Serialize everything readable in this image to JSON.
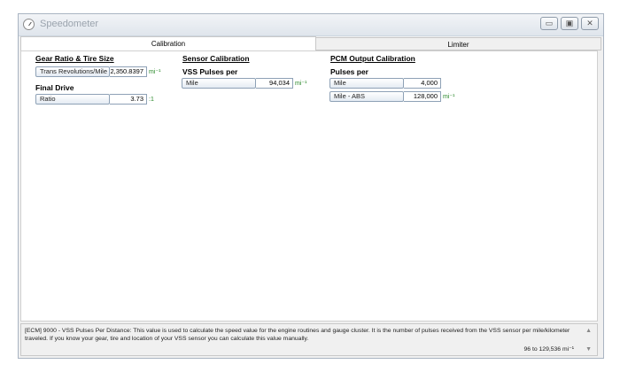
{
  "window": {
    "title": "Speedometer"
  },
  "tabs": [
    {
      "label": "Calibration"
    },
    {
      "label": "Limiter"
    }
  ],
  "gear": {
    "header": "Gear Ratio & Tire Size",
    "trans_label": "Trans Revolutions/Mile",
    "trans_value": "2,350.8397",
    "trans_unit": "mi⁻¹",
    "final_drive_title": "Final Drive",
    "ratio_label": "Ratio",
    "ratio_value": "3.73",
    "ratio_unit": ":1"
  },
  "sensor": {
    "header": "Sensor Calibration",
    "subheader": "VSS Pulses per",
    "mile_label": "Mile",
    "mile_value": "94,034",
    "mile_unit": "mi⁻¹"
  },
  "pcm": {
    "header": "PCM Output Calibration",
    "subheader": "Pulses per",
    "mile_label": "Mile",
    "mile_value": "4,000",
    "abs_label": "Mile - ABS",
    "abs_value": "128,000",
    "abs_unit": "mi⁻¹"
  },
  "info": {
    "text": "[ECM] 9000 - VSS Pulses Per Distance: This value is used to calculate the speed value for the engine routines and gauge cluster. It is the number of pulses received from the VSS sensor per mile/kilometer traveled. If you know your gear, tire and location of your VSS sensor you can calculate this value manually.",
    "range": "96 to 129,536 mi⁻¹"
  },
  "icons": {
    "minimize": "minimize-icon",
    "maximize": "maximize-icon",
    "close": "close-icon",
    "app": "speedometer-icon"
  }
}
